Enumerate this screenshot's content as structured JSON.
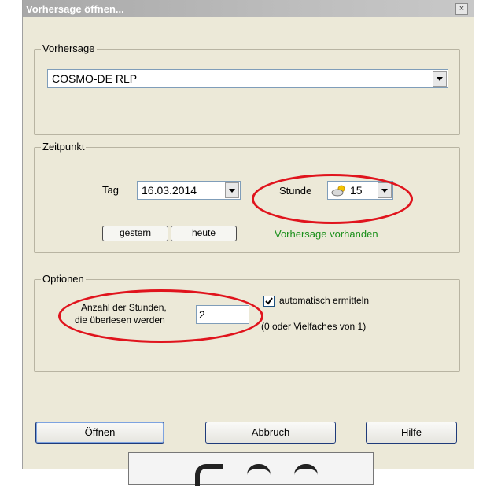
{
  "window": {
    "title": "Vorhersage öffnen...",
    "close_glyph": "×"
  },
  "vorhersage": {
    "legend": "Vorhersage",
    "selected": "COSMO-DE RLP"
  },
  "zeitpunkt": {
    "legend": "Zeitpunkt",
    "tag_label": "Tag",
    "tag_value": "16.03.2014",
    "stunde_label": "Stunde",
    "stunde_value": "15",
    "stunde_icon": "weather-icon",
    "gestern_label": "gestern",
    "heute_label": "heute",
    "status": "Vorhersage vorhanden",
    "status_color": "#1a8f1a"
  },
  "optionen": {
    "legend": "Optionen",
    "hours_label_line1": "Anzahl der Stunden,",
    "hours_label_line2": "die überlesen werden",
    "hours_value": "2",
    "auto_label": "automatisch ermitteln",
    "auto_checked": true,
    "hint": "(0 oder Vielfaches von 1)"
  },
  "buttons": {
    "open": "Öffnen",
    "cancel": "Abbruch",
    "help": "Hilfe"
  },
  "annotation_color": "#e0141d"
}
